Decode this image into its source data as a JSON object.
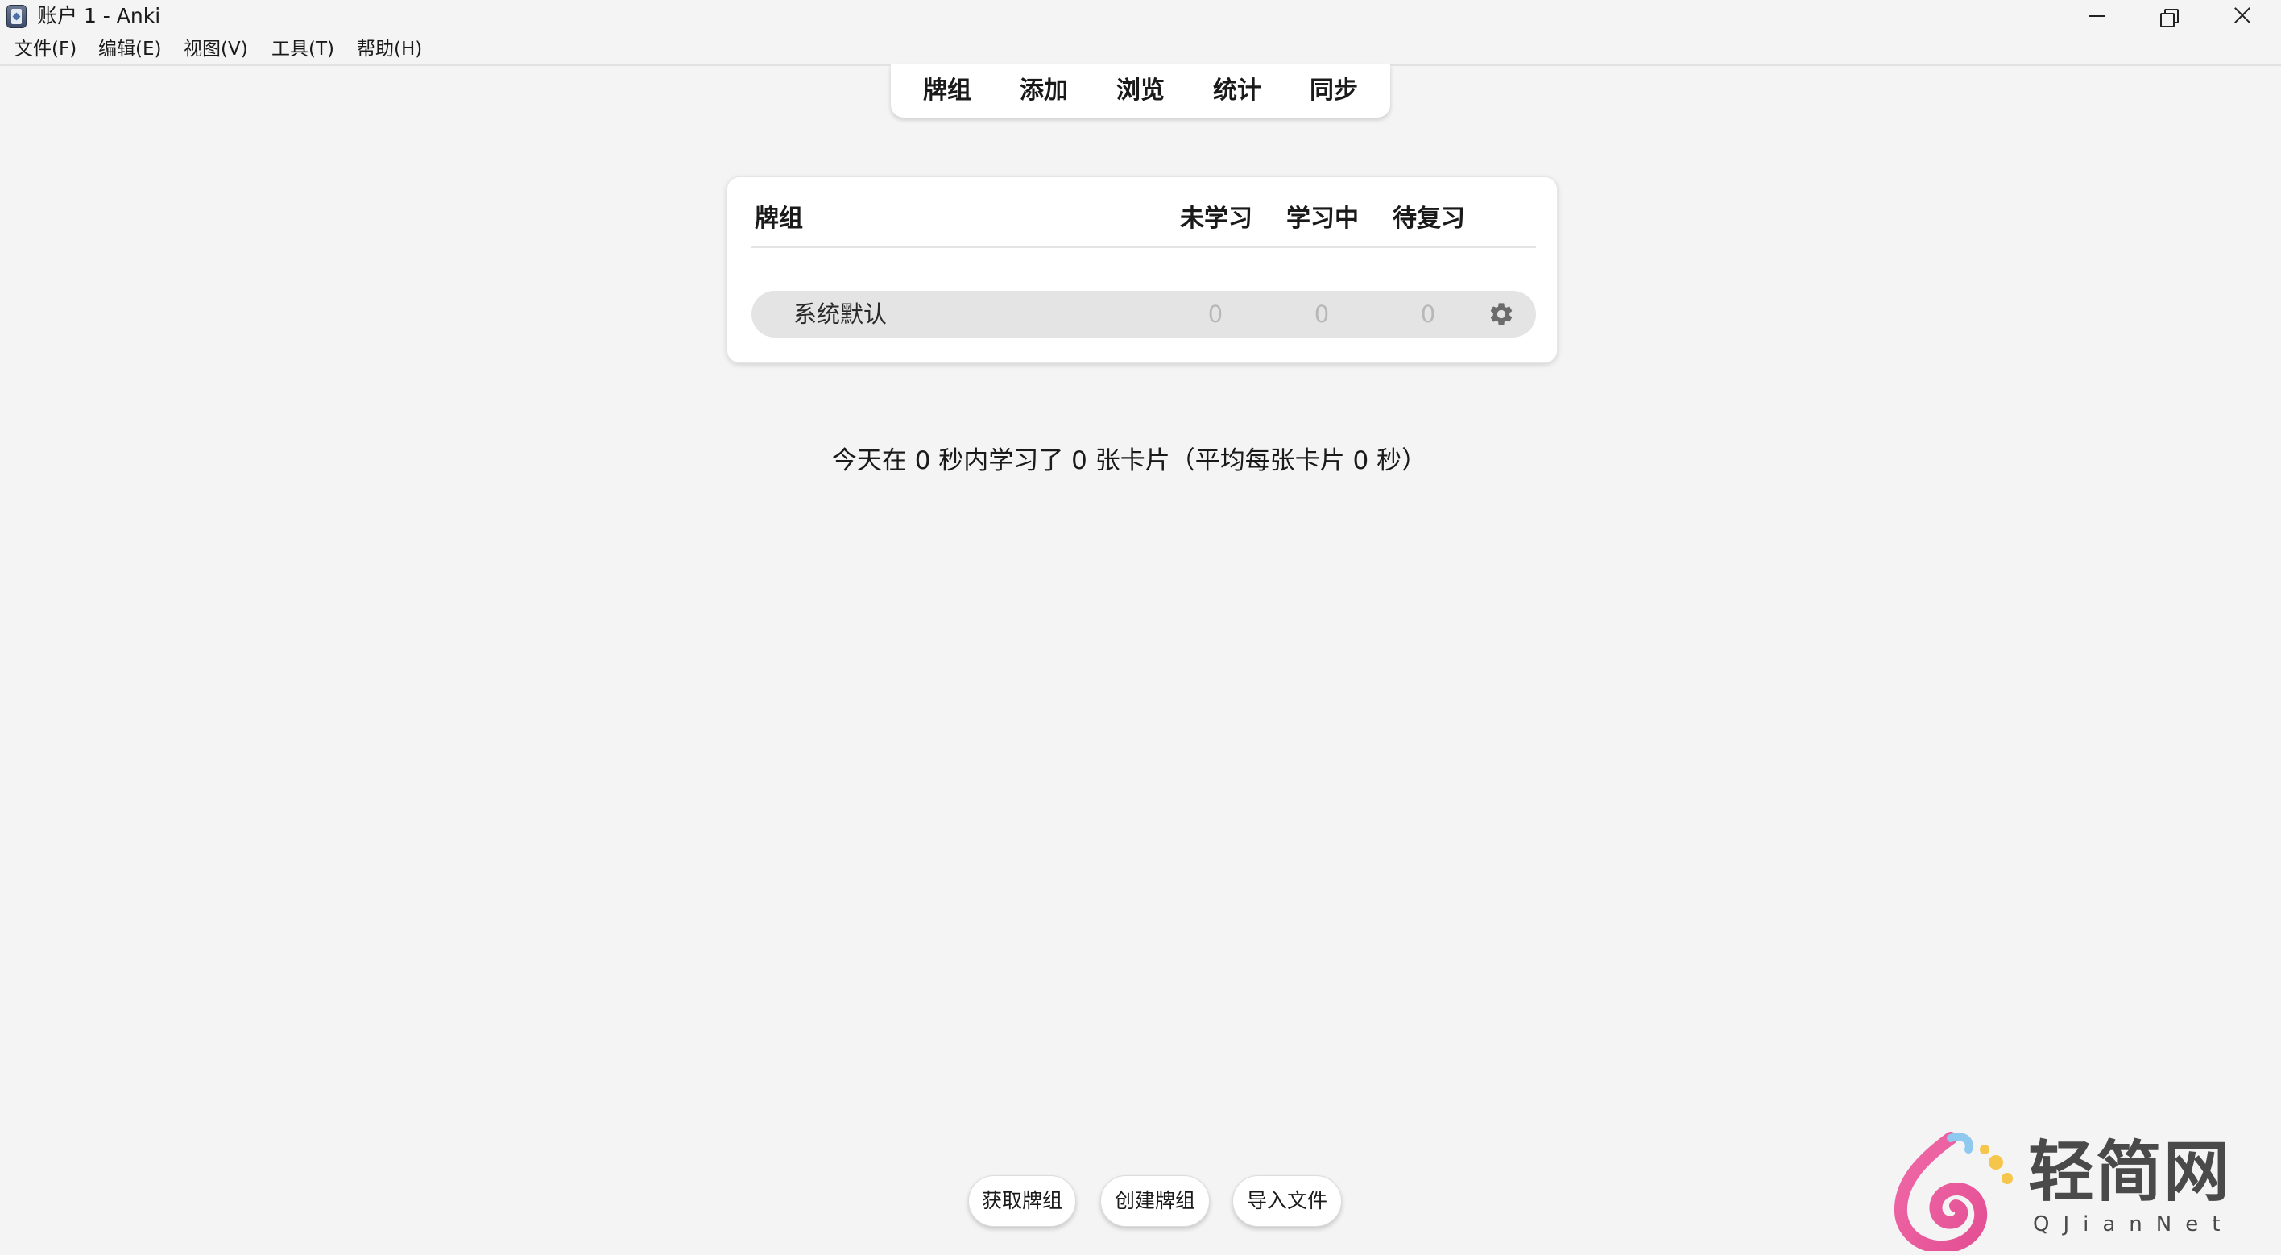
{
  "window": {
    "title": "账户 1 - Anki"
  },
  "menu": {
    "items": [
      {
        "label": "文件(F)"
      },
      {
        "label": "编辑(E)"
      },
      {
        "label": "视图(V)"
      },
      {
        "label": "工具(T)"
      },
      {
        "label": "帮助(H)"
      }
    ]
  },
  "toolbar": {
    "tabs": [
      {
        "label": "牌组"
      },
      {
        "label": "添加"
      },
      {
        "label": "浏览"
      },
      {
        "label": "统计"
      },
      {
        "label": "同步"
      }
    ]
  },
  "deck_table": {
    "headers": {
      "deck": "牌组",
      "new": "未学习",
      "learning": "学习中",
      "due": "待复习"
    },
    "rows": [
      {
        "name": "系统默认",
        "new": "0",
        "learning": "0",
        "due": "0",
        "options_icon": "gear-icon"
      }
    ]
  },
  "study_summary": "今天在 0 秒内学习了 0 张卡片（平均每张卡片 0 秒）",
  "bottom_buttons": {
    "get_shared": "获取牌组",
    "create_deck": "创建牌组",
    "import_file": "导入文件"
  },
  "watermark": {
    "text": "轻简网",
    "subtext": "QJianNet"
  }
}
